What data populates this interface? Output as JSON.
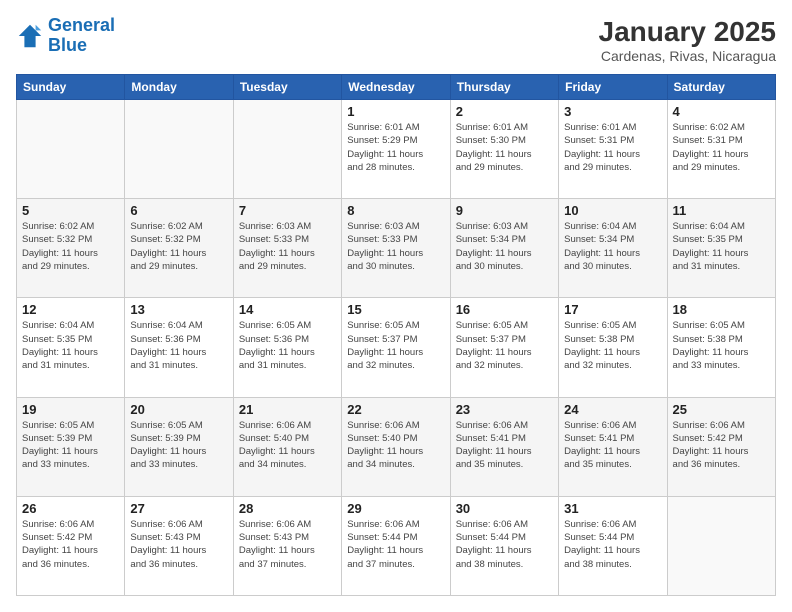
{
  "logo": {
    "line1": "General",
    "line2": "Blue"
  },
  "header": {
    "month": "January 2025",
    "location": "Cardenas, Rivas, Nicaragua"
  },
  "weekdays": [
    "Sunday",
    "Monday",
    "Tuesday",
    "Wednesday",
    "Thursday",
    "Friday",
    "Saturday"
  ],
  "weeks": [
    [
      {
        "day": "",
        "info": ""
      },
      {
        "day": "",
        "info": ""
      },
      {
        "day": "",
        "info": ""
      },
      {
        "day": "1",
        "info": "Sunrise: 6:01 AM\nSunset: 5:29 PM\nDaylight: 11 hours\nand 28 minutes."
      },
      {
        "day": "2",
        "info": "Sunrise: 6:01 AM\nSunset: 5:30 PM\nDaylight: 11 hours\nand 29 minutes."
      },
      {
        "day": "3",
        "info": "Sunrise: 6:01 AM\nSunset: 5:31 PM\nDaylight: 11 hours\nand 29 minutes."
      },
      {
        "day": "4",
        "info": "Sunrise: 6:02 AM\nSunset: 5:31 PM\nDaylight: 11 hours\nand 29 minutes."
      }
    ],
    [
      {
        "day": "5",
        "info": "Sunrise: 6:02 AM\nSunset: 5:32 PM\nDaylight: 11 hours\nand 29 minutes."
      },
      {
        "day": "6",
        "info": "Sunrise: 6:02 AM\nSunset: 5:32 PM\nDaylight: 11 hours\nand 29 minutes."
      },
      {
        "day": "7",
        "info": "Sunrise: 6:03 AM\nSunset: 5:33 PM\nDaylight: 11 hours\nand 29 minutes."
      },
      {
        "day": "8",
        "info": "Sunrise: 6:03 AM\nSunset: 5:33 PM\nDaylight: 11 hours\nand 30 minutes."
      },
      {
        "day": "9",
        "info": "Sunrise: 6:03 AM\nSunset: 5:34 PM\nDaylight: 11 hours\nand 30 minutes."
      },
      {
        "day": "10",
        "info": "Sunrise: 6:04 AM\nSunset: 5:34 PM\nDaylight: 11 hours\nand 30 minutes."
      },
      {
        "day": "11",
        "info": "Sunrise: 6:04 AM\nSunset: 5:35 PM\nDaylight: 11 hours\nand 31 minutes."
      }
    ],
    [
      {
        "day": "12",
        "info": "Sunrise: 6:04 AM\nSunset: 5:35 PM\nDaylight: 11 hours\nand 31 minutes."
      },
      {
        "day": "13",
        "info": "Sunrise: 6:04 AM\nSunset: 5:36 PM\nDaylight: 11 hours\nand 31 minutes."
      },
      {
        "day": "14",
        "info": "Sunrise: 6:05 AM\nSunset: 5:36 PM\nDaylight: 11 hours\nand 31 minutes."
      },
      {
        "day": "15",
        "info": "Sunrise: 6:05 AM\nSunset: 5:37 PM\nDaylight: 11 hours\nand 32 minutes."
      },
      {
        "day": "16",
        "info": "Sunrise: 6:05 AM\nSunset: 5:37 PM\nDaylight: 11 hours\nand 32 minutes."
      },
      {
        "day": "17",
        "info": "Sunrise: 6:05 AM\nSunset: 5:38 PM\nDaylight: 11 hours\nand 32 minutes."
      },
      {
        "day": "18",
        "info": "Sunrise: 6:05 AM\nSunset: 5:38 PM\nDaylight: 11 hours\nand 33 minutes."
      }
    ],
    [
      {
        "day": "19",
        "info": "Sunrise: 6:05 AM\nSunset: 5:39 PM\nDaylight: 11 hours\nand 33 minutes."
      },
      {
        "day": "20",
        "info": "Sunrise: 6:05 AM\nSunset: 5:39 PM\nDaylight: 11 hours\nand 33 minutes."
      },
      {
        "day": "21",
        "info": "Sunrise: 6:06 AM\nSunset: 5:40 PM\nDaylight: 11 hours\nand 34 minutes."
      },
      {
        "day": "22",
        "info": "Sunrise: 6:06 AM\nSunset: 5:40 PM\nDaylight: 11 hours\nand 34 minutes."
      },
      {
        "day": "23",
        "info": "Sunrise: 6:06 AM\nSunset: 5:41 PM\nDaylight: 11 hours\nand 35 minutes."
      },
      {
        "day": "24",
        "info": "Sunrise: 6:06 AM\nSunset: 5:41 PM\nDaylight: 11 hours\nand 35 minutes."
      },
      {
        "day": "25",
        "info": "Sunrise: 6:06 AM\nSunset: 5:42 PM\nDaylight: 11 hours\nand 36 minutes."
      }
    ],
    [
      {
        "day": "26",
        "info": "Sunrise: 6:06 AM\nSunset: 5:42 PM\nDaylight: 11 hours\nand 36 minutes."
      },
      {
        "day": "27",
        "info": "Sunrise: 6:06 AM\nSunset: 5:43 PM\nDaylight: 11 hours\nand 36 minutes."
      },
      {
        "day": "28",
        "info": "Sunrise: 6:06 AM\nSunset: 5:43 PM\nDaylight: 11 hours\nand 37 minutes."
      },
      {
        "day": "29",
        "info": "Sunrise: 6:06 AM\nSunset: 5:44 PM\nDaylight: 11 hours\nand 37 minutes."
      },
      {
        "day": "30",
        "info": "Sunrise: 6:06 AM\nSunset: 5:44 PM\nDaylight: 11 hours\nand 38 minutes."
      },
      {
        "day": "31",
        "info": "Sunrise: 6:06 AM\nSunset: 5:44 PM\nDaylight: 11 hours\nand 38 minutes."
      },
      {
        "day": "",
        "info": ""
      }
    ]
  ]
}
